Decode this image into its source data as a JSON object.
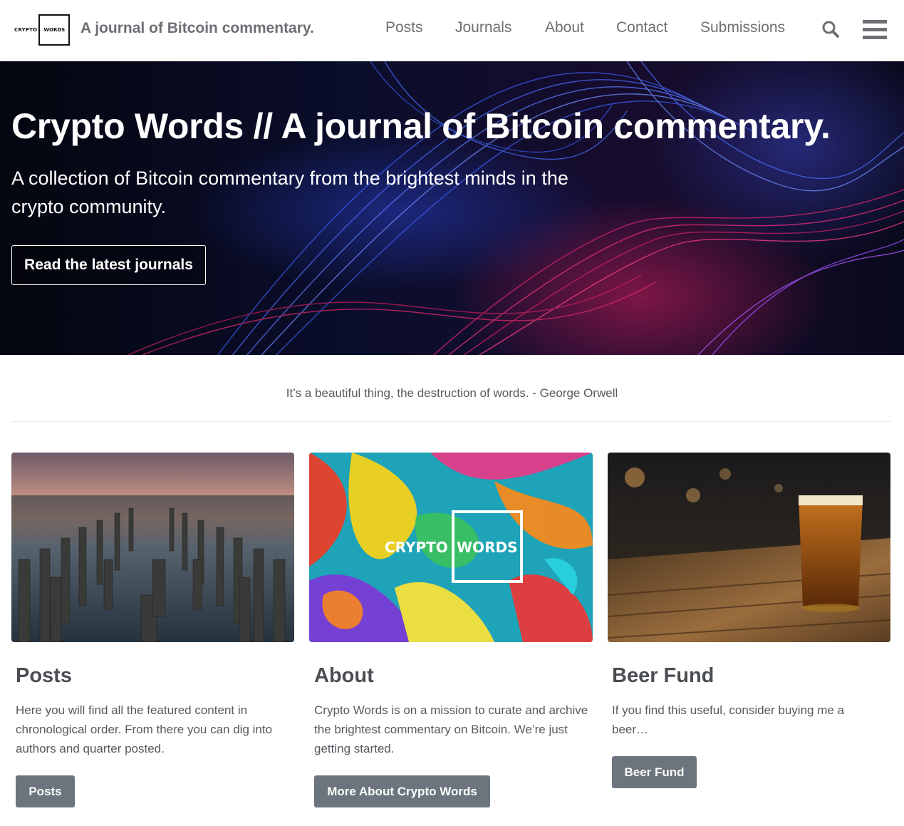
{
  "header": {
    "logo_left": "CRYPTO",
    "logo_box": "WORDS",
    "site_title": "A journal of Bitcoin commentary.",
    "nav": [
      "Posts",
      "Journals",
      "About",
      "Contact",
      "Submissions"
    ],
    "search_icon": "search-icon",
    "menu_icon": "hamburger-menu-icon"
  },
  "hero": {
    "title": "Crypto Words // A journal of Bitcoin commentary.",
    "subtitle": "A collection of Bitcoin commentary from the brightest minds in the crypto community.",
    "button": "Read the latest journals"
  },
  "quote": "It’s a beautiful thing, the destruction of words. - George Orwell",
  "cards": [
    {
      "title": "Posts",
      "text": "Here you will find all the featured content in chronological order. From there you can dig into authors and quarter posted.",
      "button": "Posts"
    },
    {
      "title": "About",
      "text": "Crypto Words is on a mission to curate and archive the brightest commentary on Bitcoin. We’re just getting started.",
      "button": "More About Crypto Words",
      "image_logo_left": "CRYPTO",
      "image_logo_right": "WORDS"
    },
    {
      "title": "Beer Fund",
      "text": "If you find this useful, consider buying me a beer…",
      "button": "Beer Fund"
    }
  ],
  "colors": {
    "nav_text": "#6c6f73",
    "heading": "#4a4e53",
    "body_text": "#555a5f",
    "button_bg": "#6c757d"
  }
}
